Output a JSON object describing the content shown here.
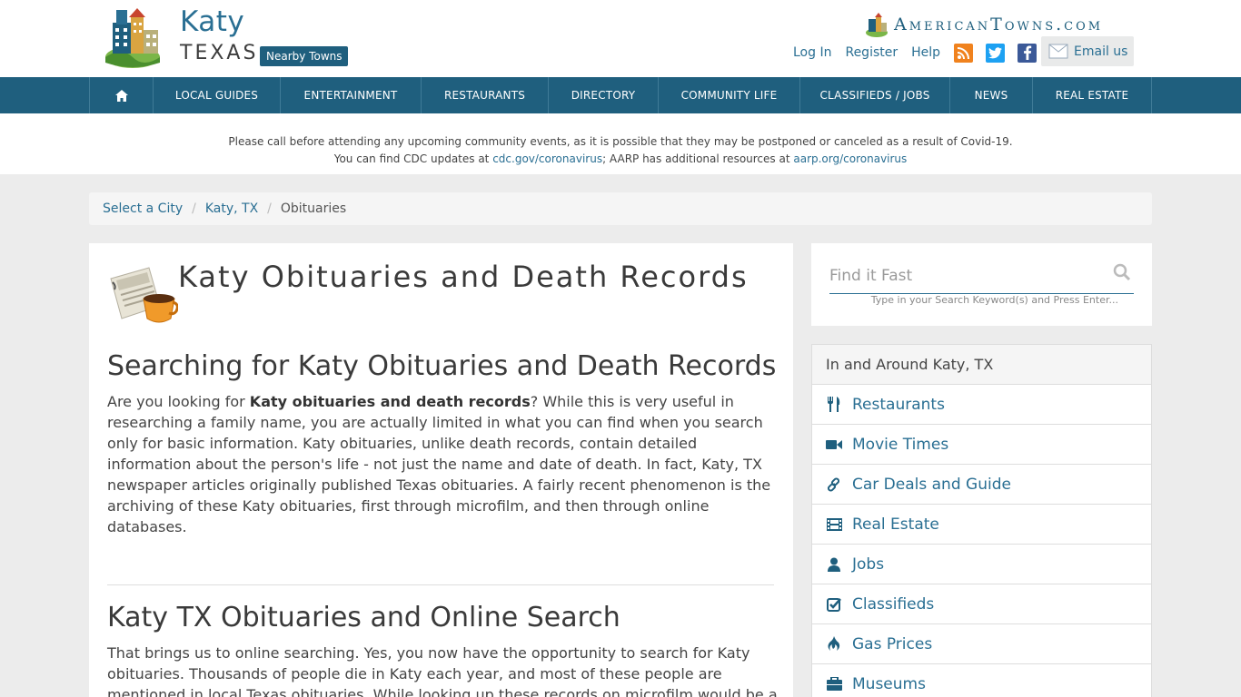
{
  "header": {
    "city": "Katy",
    "state": "TEXAS",
    "nearby_label": "Nearby Towns",
    "brand": "AmericanTowns.com",
    "links": [
      "Log In",
      "Register",
      "Help"
    ],
    "email_label": "Email us"
  },
  "nav": {
    "items": [
      "LOCAL GUIDES",
      "ENTERTAINMENT",
      "RESTAURANTS",
      "DIRECTORY",
      "COMMUNITY LIFE",
      "CLASSIFIEDS / JOBS",
      "NEWS",
      "REAL ESTATE"
    ]
  },
  "notice": {
    "line1": "Please call before attending any upcoming community events, as it is possible that they may be postponed or canceled as a result of Covid-19.",
    "line2_prefix": "You can find CDC updates at ",
    "cdc_link": "cdc.gov/coronavirus",
    "line2_mid": "; AARP has additional resources at ",
    "aarp_link": "aarp.org/coronavirus"
  },
  "breadcrumb": [
    "Select a City",
    "Katy, TX",
    "Obituaries"
  ],
  "main": {
    "title": "Katy Obituaries and Death Records",
    "section1_heading": "Searching for Katy Obituaries and Death Records",
    "section1_prefix": "Are you looking for ",
    "section1_bold": "Katy obituaries and death records",
    "section1_rest": "? While this is very useful in researching a family name, you are actually limited in what you can find when you search only for basic information. Katy obituaries, unlike death records, contain detailed information about the person's life - not just the name and date of death. In fact, Katy, TX newspaper articles originally published Texas obituaries. A fairly recent phenomenon is the archiving of these Katy obituaries, first through microfilm, and then through online databases.",
    "section2_heading": "Katy TX Obituaries and Online Search",
    "section2_text": "That brings us to online searching. Yes, you now have the opportunity to search for Katy obituaries. Thousands of people die in Katy each year, and most of these people are mentioned in local Texas obituaries. While looking up these records on microfilm would be a chore, with"
  },
  "search": {
    "placeholder": "Find it Fast",
    "hint": "Type in your Search Keyword(s) and Press Enter..."
  },
  "around": {
    "heading": "In and Around Katy, TX",
    "items": [
      {
        "label": "Restaurants",
        "icon": "fork-knife-icon"
      },
      {
        "label": "Movie Times",
        "icon": "video-camera-icon"
      },
      {
        "label": "Car Deals and Guide",
        "icon": "link-icon"
      },
      {
        "label": "Real Estate",
        "icon": "film-strip-icon"
      },
      {
        "label": "Jobs",
        "icon": "person-icon"
      },
      {
        "label": "Classifieds",
        "icon": "check-square-icon"
      },
      {
        "label": "Gas Prices",
        "icon": "fire-icon"
      },
      {
        "label": "Museums",
        "icon": "briefcase-icon"
      }
    ]
  },
  "colors": {
    "brand_teal": "#1f5f7e",
    "link_blue": "#2a6f93",
    "rss_orange": "#f0821e",
    "twitter_blue": "#1da1f2",
    "facebook_blue": "#3b5998"
  }
}
